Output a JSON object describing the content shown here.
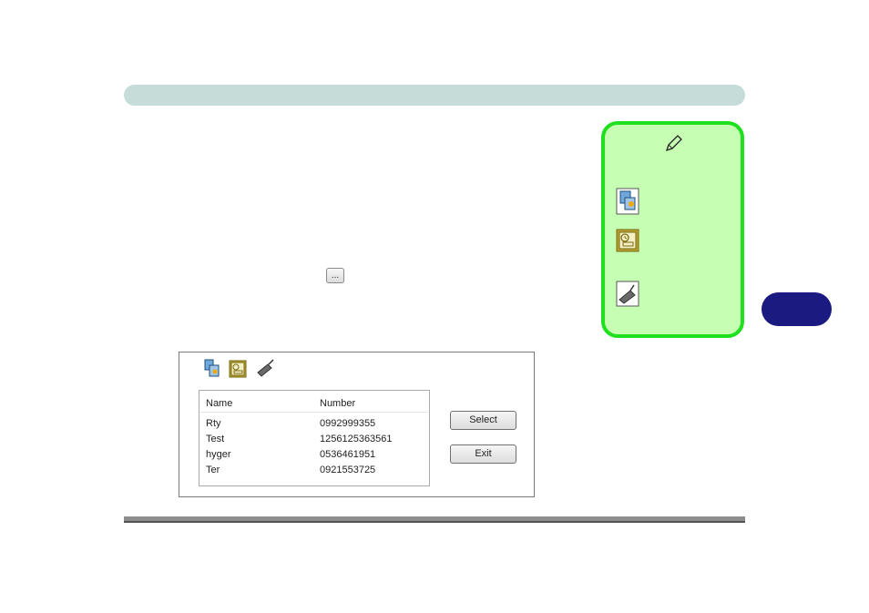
{
  "page": {
    "inline_button_label": "..."
  },
  "note_box": {
    "pencil_icon": "pencil-icon",
    "icons": [
      "sim-card-icon",
      "message-history-icon",
      "usb-modem-icon"
    ],
    "accent_color": "#1ee01e",
    "background_color": "#c6ffb3"
  },
  "dialog": {
    "toolbar_icons": [
      "sim-card-icon",
      "message-history-icon",
      "usb-modem-icon"
    ],
    "list": {
      "columns": [
        "Name",
        "Number"
      ],
      "rows": [
        {
          "name": "Rty",
          "number": "0992999355"
        },
        {
          "name": "Test",
          "number": "1256125363561"
        },
        {
          "name": "hyger",
          "number": "0536461951"
        },
        {
          "name": "Ter",
          "number": "0921553725"
        }
      ]
    },
    "select_label": "Select",
    "exit_label": "Exit"
  },
  "colors": {
    "header_bar": "#c5dcd8",
    "chapter_tab": "#1a1a80"
  }
}
